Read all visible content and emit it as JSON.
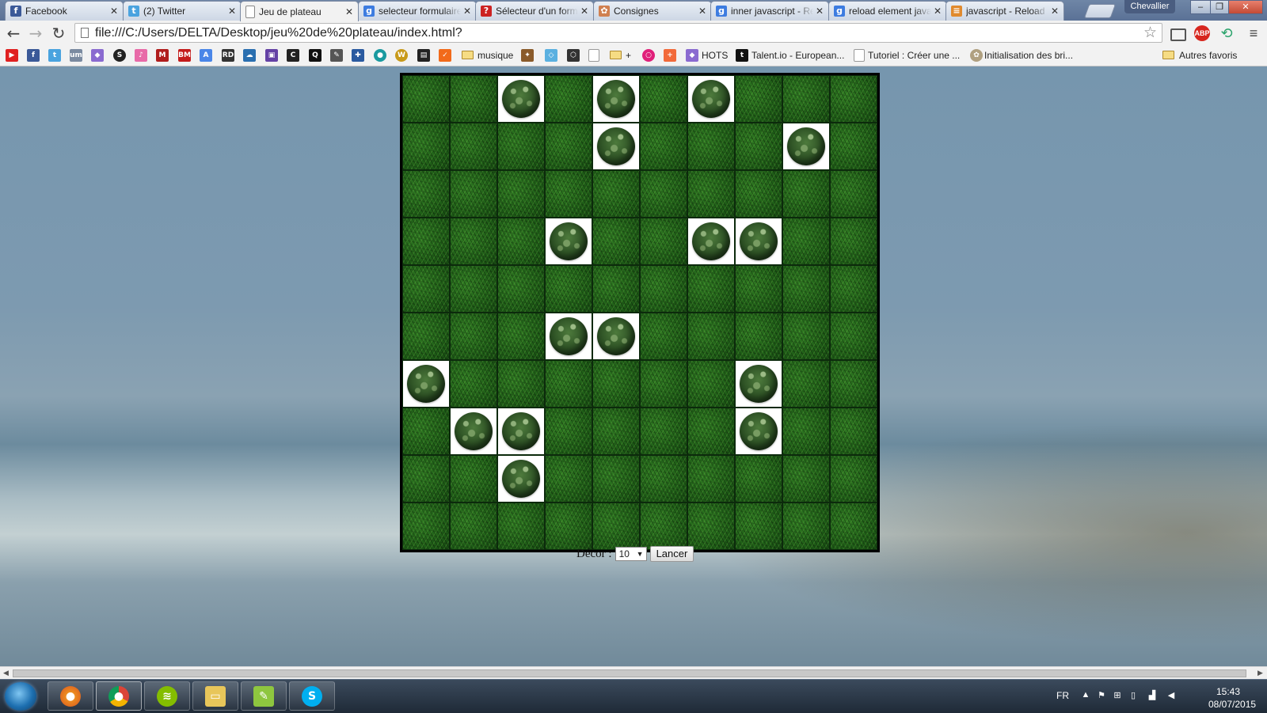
{
  "browser": {
    "tabs": [
      {
        "title": "Facebook",
        "icon": "facebook-icon",
        "color": "#3b5998",
        "glyph": "f"
      },
      {
        "title": "(2) Twitter",
        "icon": "twitter-icon",
        "color": "#4aa3df",
        "glyph": "t"
      },
      {
        "title": "Jeu de plateau",
        "icon": "page-icon",
        "color": "#ffffff",
        "glyph": ""
      },
      {
        "title": "selecteur formulaire",
        "icon": "google-icon",
        "color": "#3d7ce0",
        "glyph": "g"
      },
      {
        "title": "Sélecteur d'un formulaire",
        "icon": "question-icon",
        "color": "#cc2222",
        "glyph": "?"
      },
      {
        "title": "Consignes",
        "icon": "consignes-icon",
        "color": "#d08050",
        "glyph": "✿"
      },
      {
        "title": "inner javascript - Recherche",
        "icon": "google-icon",
        "color": "#3d7ce0",
        "glyph": "g"
      },
      {
        "title": "reload element javascript",
        "icon": "google-icon",
        "color": "#3d7ce0",
        "glyph": "g"
      },
      {
        "title": "javascript - Reload",
        "icon": "stackoverflow-icon",
        "color": "#e08a2e",
        "glyph": "≡"
      }
    ],
    "active_tab": 2,
    "profile_name": "Chevallier",
    "url": "file:///C:/Users/DELTA/Desktop/jeu%20de%20plateau/index.html?",
    "bookmarks": {
      "musique": "musique",
      "folder_plus": "+",
      "hots": "HOTS",
      "talent": "Talent.io - European...",
      "tutoriel": "Tutoriel : Créer une ...",
      "initialisation": "Initialisation des bri...",
      "autres": "Autres favoris"
    }
  },
  "page": {
    "board": {
      "rows": 10,
      "cols": 10,
      "trees": [
        [
          0,
          2
        ],
        [
          0,
          4
        ],
        [
          0,
          6
        ],
        [
          1,
          4
        ],
        [
          1,
          8
        ],
        [
          3,
          3
        ],
        [
          3,
          6
        ],
        [
          3,
          7
        ],
        [
          5,
          3
        ],
        [
          5,
          4
        ],
        [
          6,
          0
        ],
        [
          6,
          7
        ],
        [
          7,
          1
        ],
        [
          7,
          2
        ],
        [
          7,
          7
        ],
        [
          8,
          2
        ]
      ]
    },
    "decor_label": "Décor :",
    "decor_value": "10",
    "launch_label": "Lancer"
  },
  "taskbar": {
    "language": "FR",
    "time": "15:43",
    "date": "08/07/2015"
  }
}
